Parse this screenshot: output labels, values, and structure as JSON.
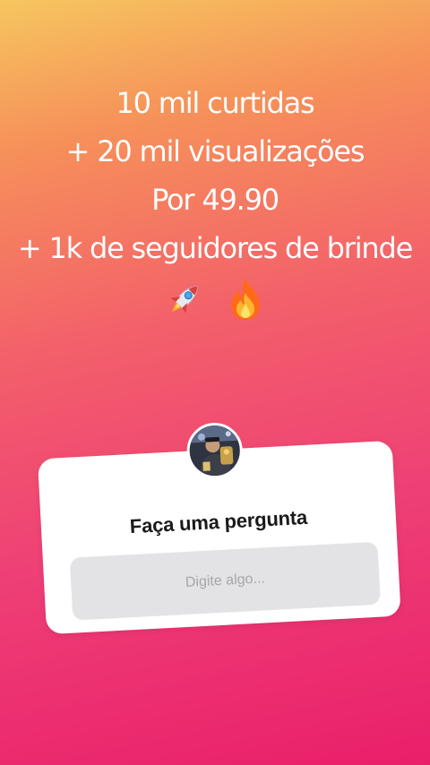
{
  "story": {
    "lines": [
      "10 mil curtidas",
      "+ 20 mil visualizações",
      "Por 49.90",
      "+ 1k de seguidores de brinde"
    ],
    "emojis": [
      "rocket-emoji",
      "fire-emoji"
    ]
  },
  "question_sticker": {
    "title": "Faça uma pergunta",
    "placeholder": "Digite algo..."
  },
  "colors": {
    "gradient_top": "#f6c65e",
    "gradient_mid": "#f3606a",
    "gradient_bottom": "#ea1f6a",
    "card": "#ffffff",
    "field": "#e3e3e5"
  }
}
